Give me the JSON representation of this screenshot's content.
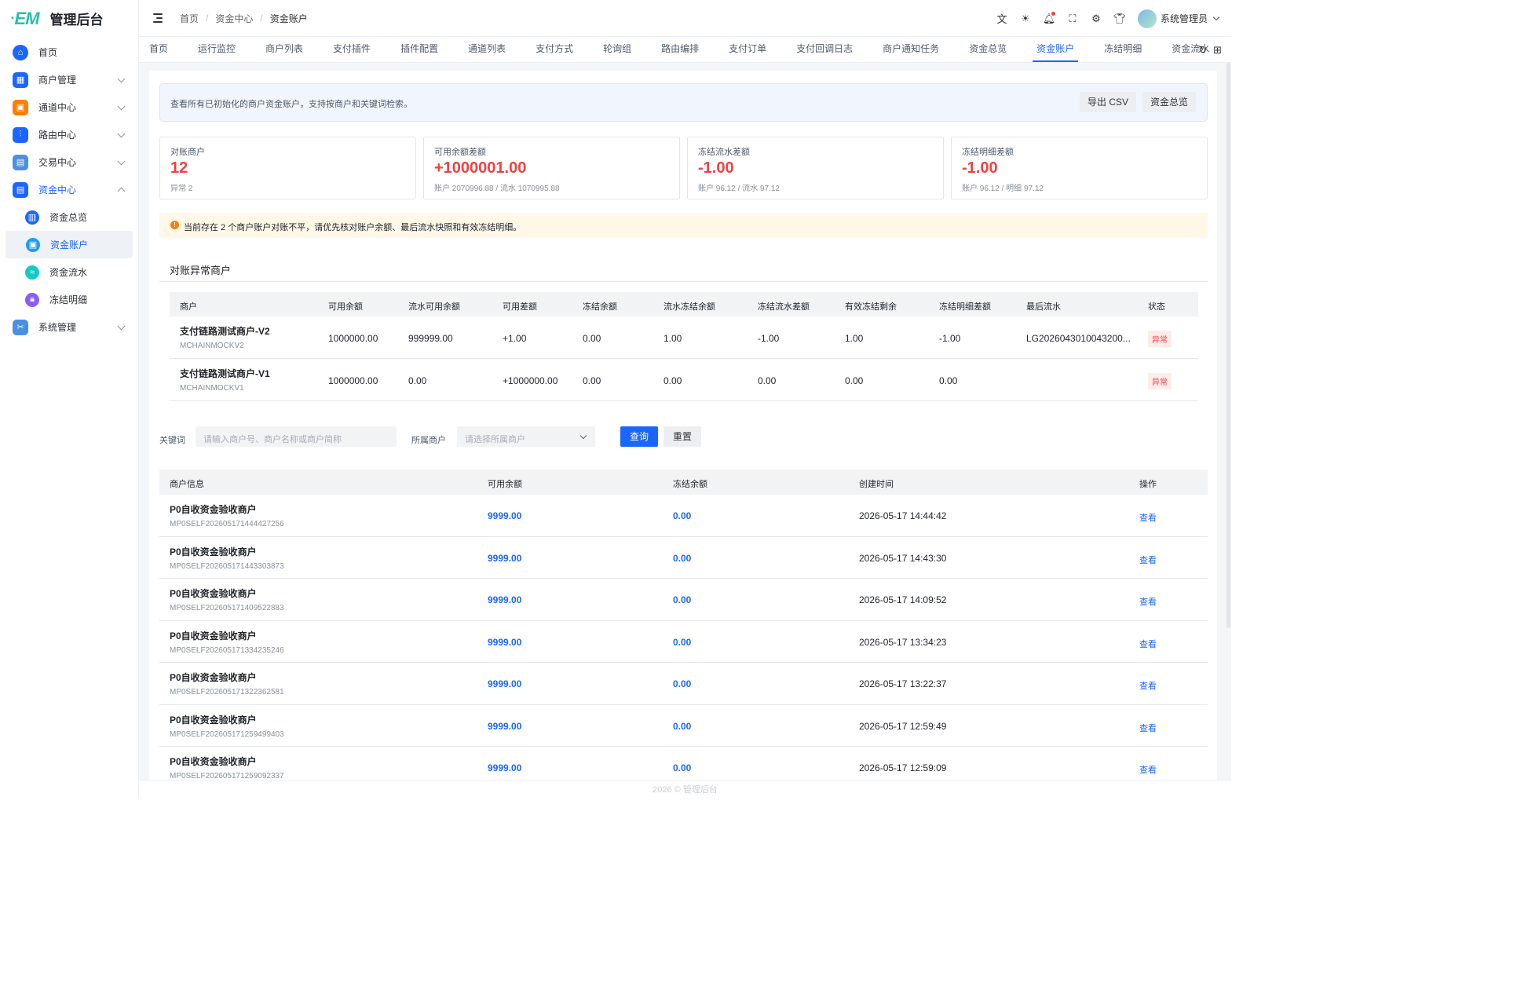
{
  "app": {
    "title": "管理后台",
    "logo_text": "EM"
  },
  "sidebar": {
    "items": [
      {
        "label": "首页",
        "icon": "home-icon",
        "color": "#1a66ff"
      },
      {
        "label": "商户管理",
        "icon": "grid-icon",
        "color": "#1a66ff"
      },
      {
        "label": "通道中心",
        "icon": "channel-icon",
        "color": "#ff7d00"
      },
      {
        "label": "路由中心",
        "icon": "route-icon",
        "color": "#1a66ff"
      },
      {
        "label": "交易中心",
        "icon": "clipboard-icon",
        "color": "#4a90e2"
      },
      {
        "label": "资金中心",
        "icon": "document-icon",
        "color": "#1a66ff"
      },
      {
        "label": "系统管理",
        "icon": "tools-icon",
        "color": "#4a90e2"
      }
    ],
    "fund_sub": [
      {
        "label": "资金总览",
        "icon": "overview-icon",
        "color": "#1a66ff"
      },
      {
        "label": "资金账户",
        "icon": "account-icon",
        "color": "#1f9cf0"
      },
      {
        "label": "资金流水",
        "icon": "flow-icon",
        "color": "#14c9c9"
      },
      {
        "label": "冻结明细",
        "icon": "lock-icon",
        "color": "#8b5cf6"
      }
    ]
  },
  "header": {
    "breadcrumb": [
      "首页",
      "资金中心",
      "资金账户"
    ],
    "user": "系统管理员"
  },
  "tabs": [
    "首页",
    "运行监控",
    "商户列表",
    "支付插件",
    "插件配置",
    "通道列表",
    "支付方式",
    "轮询组",
    "路由编排",
    "支付订单",
    "支付回调日志",
    "商户通知任务",
    "资金总览",
    "资金账户",
    "冻结明细",
    "资金流水"
  ],
  "active_tab": "资金账户",
  "notice": {
    "text": "查看所有已初始化的商户资金账户，支持按商户和关键词检索。",
    "export_btn": "导出 CSV",
    "overview_btn": "资金总览"
  },
  "stats": [
    {
      "label": "对账商户",
      "value": "12",
      "sub": "异常 2"
    },
    {
      "label": "可用余额差额",
      "value": "+1000001.00",
      "sub": "账户 2070996.88 / 流水 1070995.88"
    },
    {
      "label": "冻结流水差额",
      "value": "-1.00",
      "sub": "账户 96.12 / 流水 97.12"
    },
    {
      "label": "冻结明细差额",
      "value": "-1.00",
      "sub": "账户 96.12 / 明细 97.12"
    }
  ],
  "warning": "当前存在 2 个商户账户对账不平，请优先核对账户余额、最后流水快照和有效冻结明细。",
  "anomaly": {
    "title": "对账异常商户",
    "headers": [
      "商户",
      "可用余额",
      "流水可用余额",
      "可用差额",
      "冻结余额",
      "流水冻结余额",
      "冻结流水差额",
      "有效冻结剩余",
      "冻结明细差额",
      "最后流水",
      "状态"
    ],
    "rows": [
      {
        "name": "支付链路测试商户-V2",
        "code": "MCHAINMOCKV2",
        "cells": [
          "1000000.00",
          "999999.00",
          "+1.00",
          "0.00",
          "1.00",
          "-1.00",
          "1.00",
          "-1.00",
          "LG2026043010043200..."
        ],
        "status": "异常"
      },
      {
        "name": "支付链路测试商户-V1",
        "code": "MCHAINMOCKV1",
        "cells": [
          "1000000.00",
          "0.00",
          "+1000000.00",
          "0.00",
          "0.00",
          "0.00",
          "0.00",
          "0.00",
          ""
        ],
        "status": "异常"
      }
    ]
  },
  "filter": {
    "keyword_label": "关键词",
    "keyword_placeholder": "请输入商户号、商户名称或商户简称",
    "merchant_label": "所属商户",
    "merchant_placeholder": "请选择所属商户",
    "query_btn": "查询",
    "reset_btn": "重置"
  },
  "accounts": {
    "headers": [
      "商户信息",
      "可用余额",
      "冻结余额",
      "创建时间",
      "操作"
    ],
    "rows": [
      {
        "name": "P0自收资金验收商户",
        "code": "MP0SELF202605171444427256",
        "balance": "9999.00",
        "frozen": "0.00",
        "created": "2026-05-17 14:44:42",
        "action": "查看"
      },
      {
        "name": "P0自收资金验收商户",
        "code": "MP0SELF202605171443303873",
        "balance": "9999.00",
        "frozen": "0.00",
        "created": "2026-05-17 14:43:30",
        "action": "查看"
      },
      {
        "name": "P0自收资金验收商户",
        "code": "MP0SELF202605171409522883",
        "balance": "9999.00",
        "frozen": "0.00",
        "created": "2026-05-17 14:09:52",
        "action": "查看"
      },
      {
        "name": "P0自收资金验收商户",
        "code": "MP0SELF202605171334235246",
        "balance": "9999.00",
        "frozen": "0.00",
        "created": "2026-05-17 13:34:23",
        "action": "查看"
      },
      {
        "name": "P0自收资金验收商户",
        "code": "MP0SELF202605171322362581",
        "balance": "9999.00",
        "frozen": "0.00",
        "created": "2026-05-17 13:22:37",
        "action": "查看"
      },
      {
        "name": "P0自收资金验收商户",
        "code": "MP0SELF202605171259499403",
        "balance": "9999.00",
        "frozen": "0.00",
        "created": "2026-05-17 12:59:49",
        "action": "查看"
      },
      {
        "name": "P0自收资金验收商户",
        "code": "MP0SELF202605171259092337",
        "balance": "9999.00",
        "frozen": "0.00",
        "created": "2026-05-17 12:59:09",
        "action": "查看"
      }
    ]
  },
  "footer": "2026 © 管理后台"
}
